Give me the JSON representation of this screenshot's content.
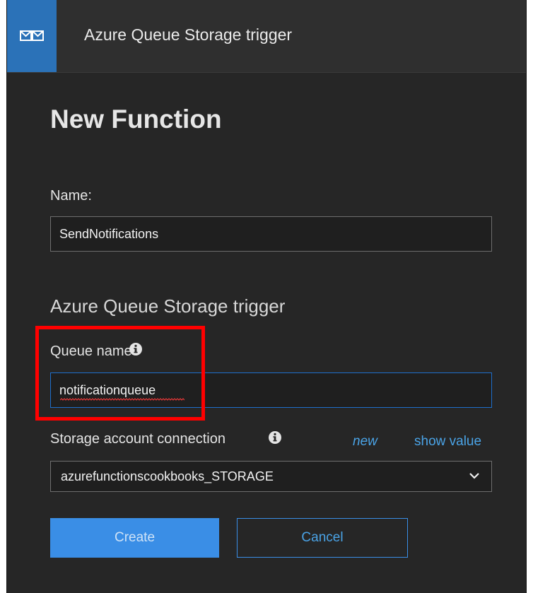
{
  "header": {
    "title": "Azure Queue Storage trigger",
    "icon": "queue-envelope-icon"
  },
  "heading": "New Function",
  "name_field": {
    "label": "Name:",
    "value": "SendNotifications"
  },
  "section_title": "Azure Queue Storage trigger",
  "queue_field": {
    "label": "Queue name",
    "value": "notificationqueue"
  },
  "storage_field": {
    "label": "Storage account connection",
    "new_link": "new",
    "show_value_link": "show value",
    "selected": "azurefunctionscookbooks_STORAGE"
  },
  "buttons": {
    "create": "Create",
    "cancel": "Cancel"
  },
  "colors": {
    "accent": "#3a8ee6",
    "highlight": "#ff0000",
    "panel": "#262626"
  }
}
